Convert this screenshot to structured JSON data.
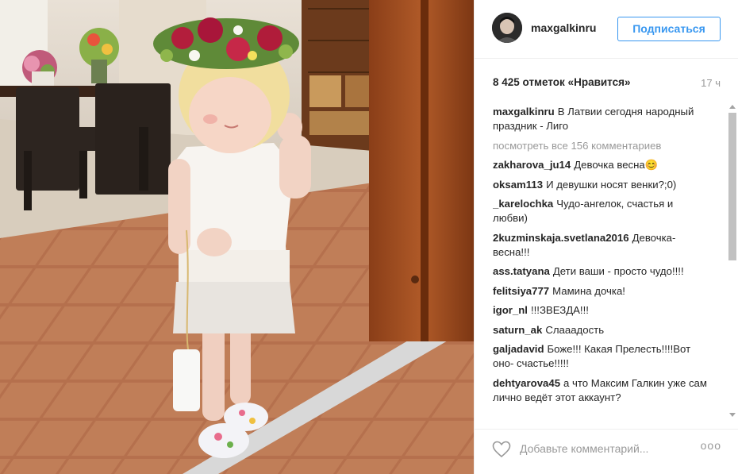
{
  "header": {
    "username": "maxgalkinru",
    "follow_label": "Подписаться"
  },
  "stats": {
    "likes": "8 425 отметок «Нравится»",
    "time": "17 ч"
  },
  "caption": {
    "user": "maxgalkinru",
    "text": "В Латвии сегодня народный праздник - Лиго"
  },
  "view_all": "посмотреть все 156 комментариев",
  "comments": [
    {
      "user": "zakharova_ju14",
      "text": "Девочка весна😊"
    },
    {
      "user": "oksam113",
      "text": "И девушки носят венки?;0)"
    },
    {
      "user": "_karelochka",
      "text": "Чудо-ангелок, счастья и любви)"
    },
    {
      "user": "2kuzminskaja.svetlana2016",
      "text": "Девочка-весна!!!"
    },
    {
      "user": "ass.tatyana",
      "text": "Дети ваши - просто чудо!!!!"
    },
    {
      "user": "felitsiya777",
      "text": "Мамина дочка!"
    },
    {
      "user": "igor_nl",
      "text": "!!!ЗВЕЗДА!!!"
    },
    {
      "user": "saturn_ak",
      "text": "Слааадость"
    },
    {
      "user": "galjadavid",
      "text": "Боже!!! Какая Прелесть!!!!Вот оно- счастье!!!!!"
    },
    {
      "user": "dehtyarova45",
      "text": "а что Максим Галкин уже сам лично ведёт этот аккаунт?"
    }
  ],
  "footer": {
    "comment_placeholder": "Добавьте комментарий...",
    "more": "ooo"
  },
  "colors": {
    "accent": "#3897f0",
    "muted": "#999999",
    "border": "#efefef"
  }
}
